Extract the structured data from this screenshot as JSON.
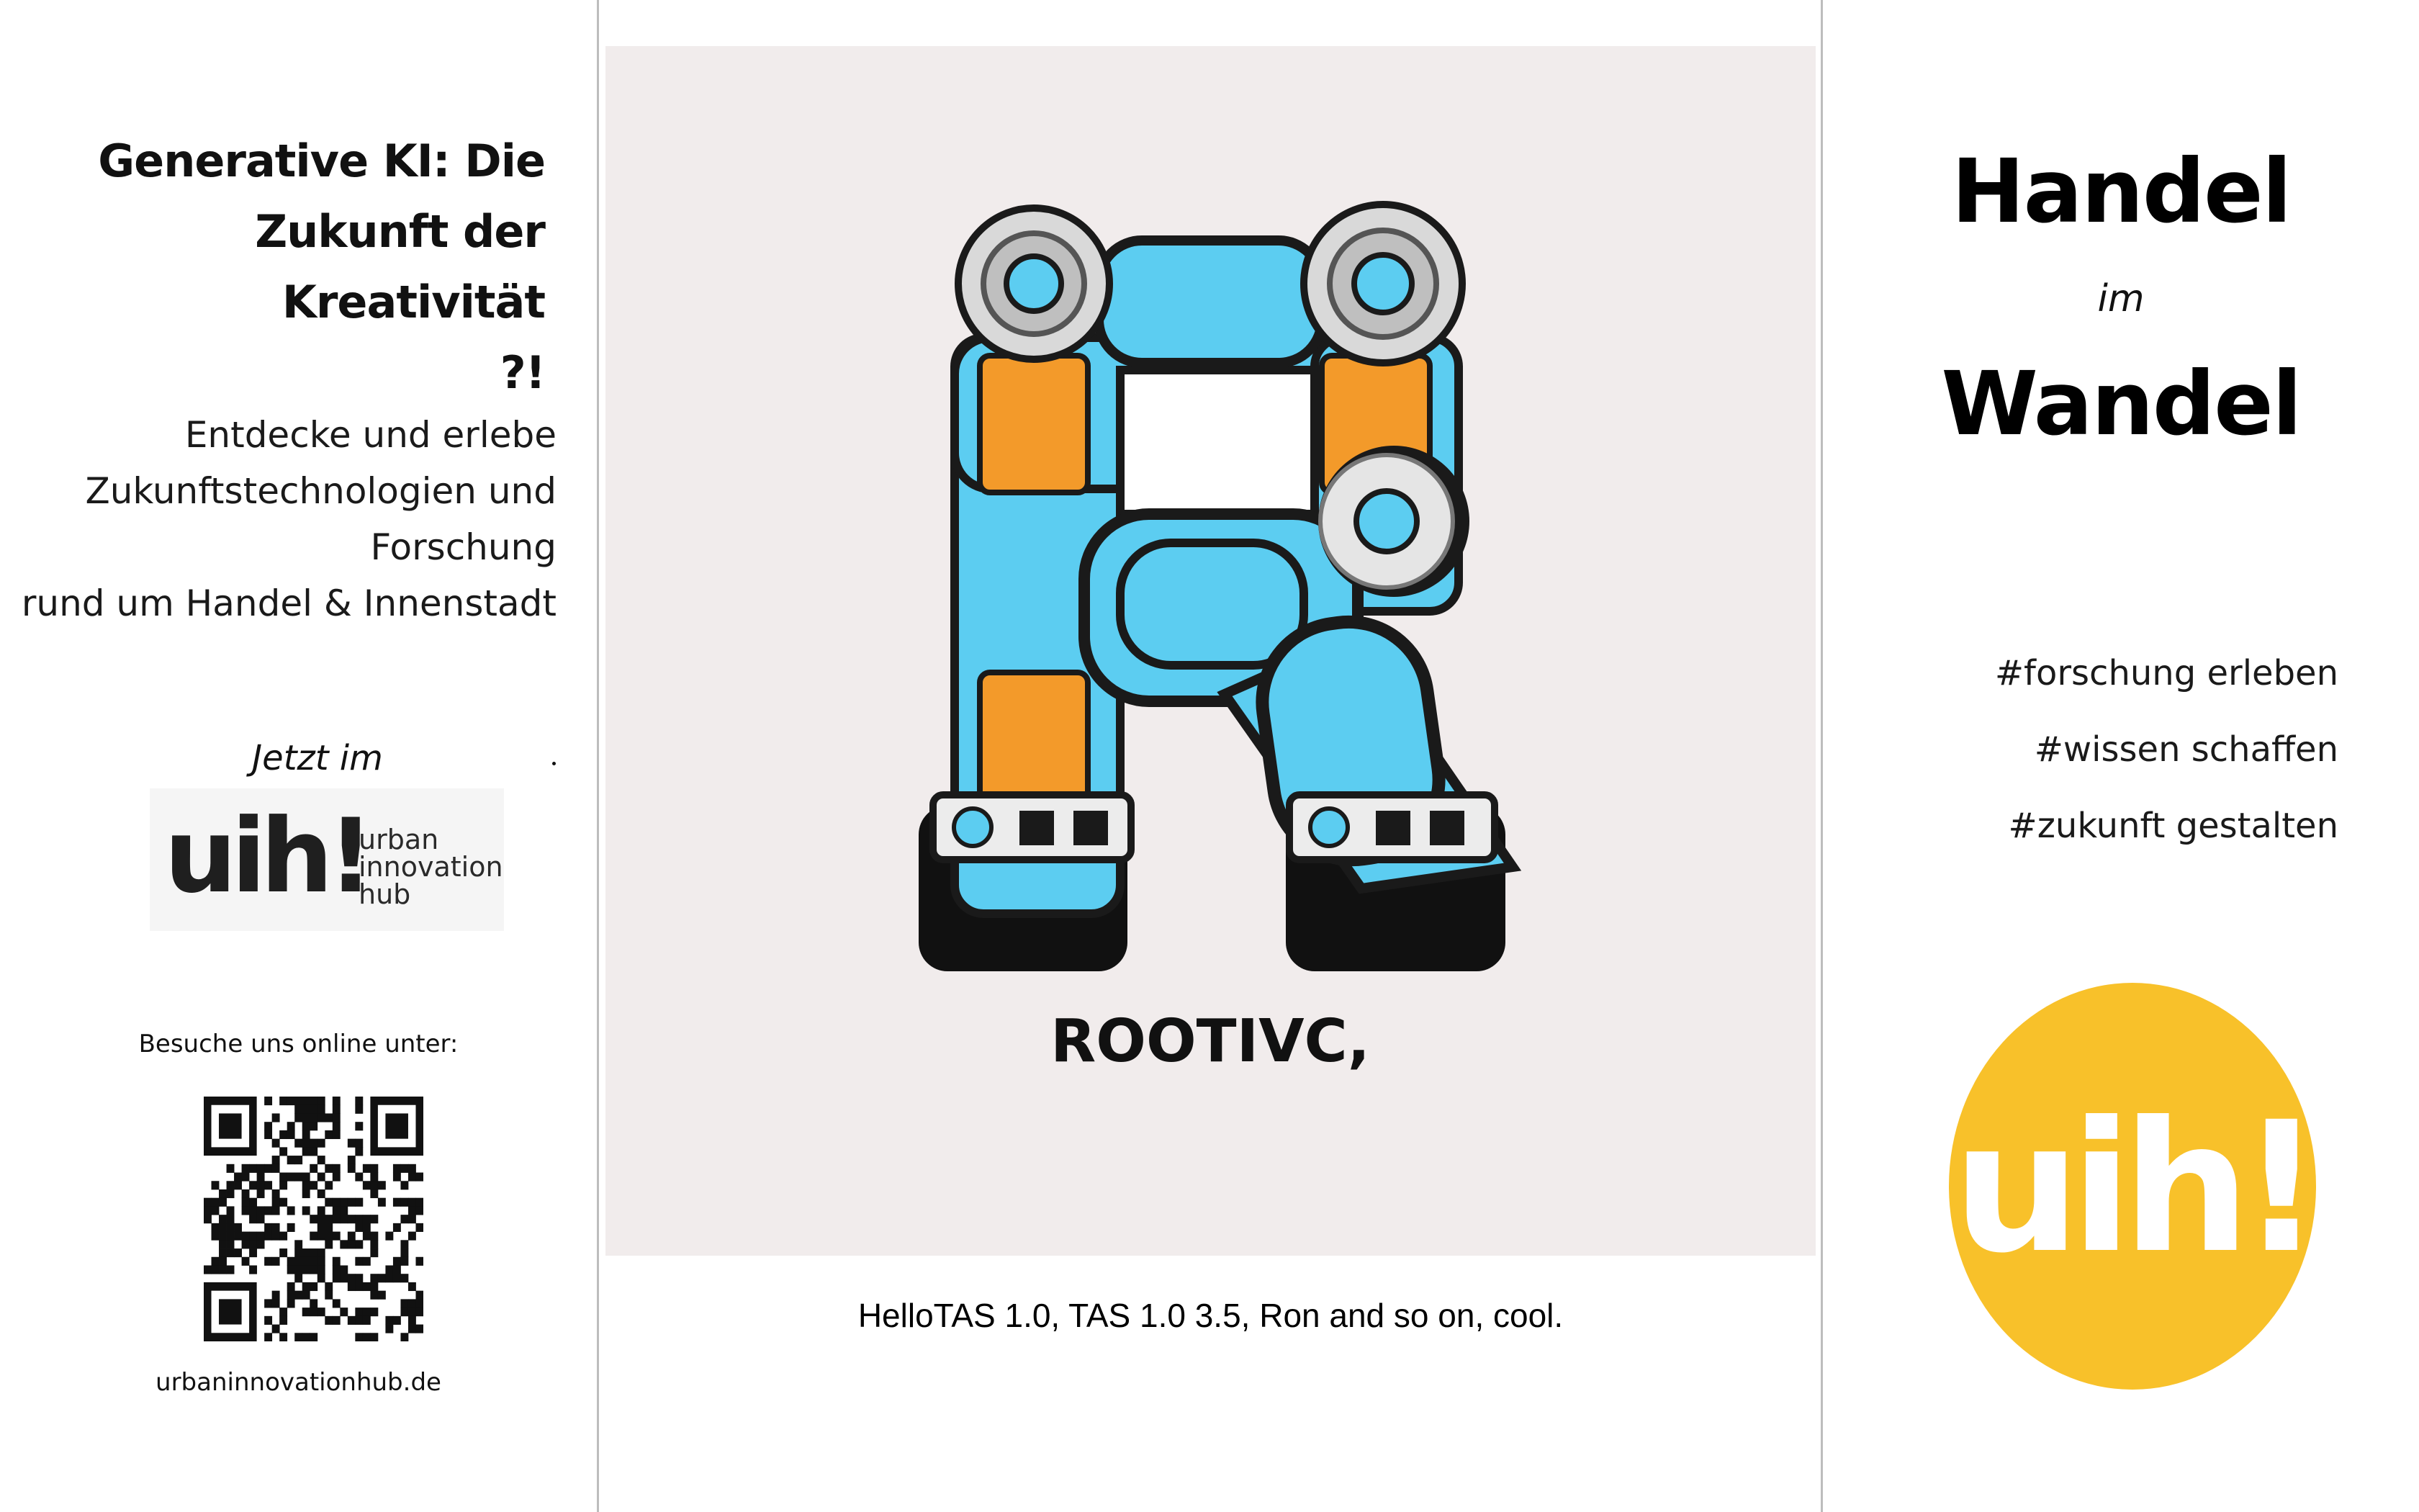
{
  "left_panel": {
    "heading_lines": [
      "Generative KI: Die",
      "Zukunft der Kreativität",
      "?!"
    ],
    "intro_lines": [
      "Entdecke und erlebe",
      "Zukunftstechnologien und",
      "Forschung",
      "rund um Handel & Innenstadt"
    ],
    "now_label": "Jetzt im",
    "logo": {
      "word": "uih!",
      "sub_lines": [
        "urban",
        "innovation",
        "hub"
      ]
    },
    "visit_label": "Besuche uns online unter:",
    "url": "urbaninnovationhub.de"
  },
  "center_panel": {
    "artwork_text": "ROOTIVC,",
    "caption": "HelloTAS 1.0, TAS 1.0 3.5, Ron and so on, cool."
  },
  "right_panel": {
    "title_top": "Handel",
    "title_mid": "im",
    "title_bottom": "Wandel",
    "hashtags": [
      "#forschung erleben",
      "#wissen schaffen",
      "#zukunft gestalten"
    ],
    "badge_word": "uih!",
    "badge_color": "#f8c12a"
  },
  "colors": {
    "robot_blue": "#5ccdf1",
    "robot_orange": "#f39a2a",
    "outline": "#1a1a1a",
    "artwork_bg": "#f1ecec"
  }
}
